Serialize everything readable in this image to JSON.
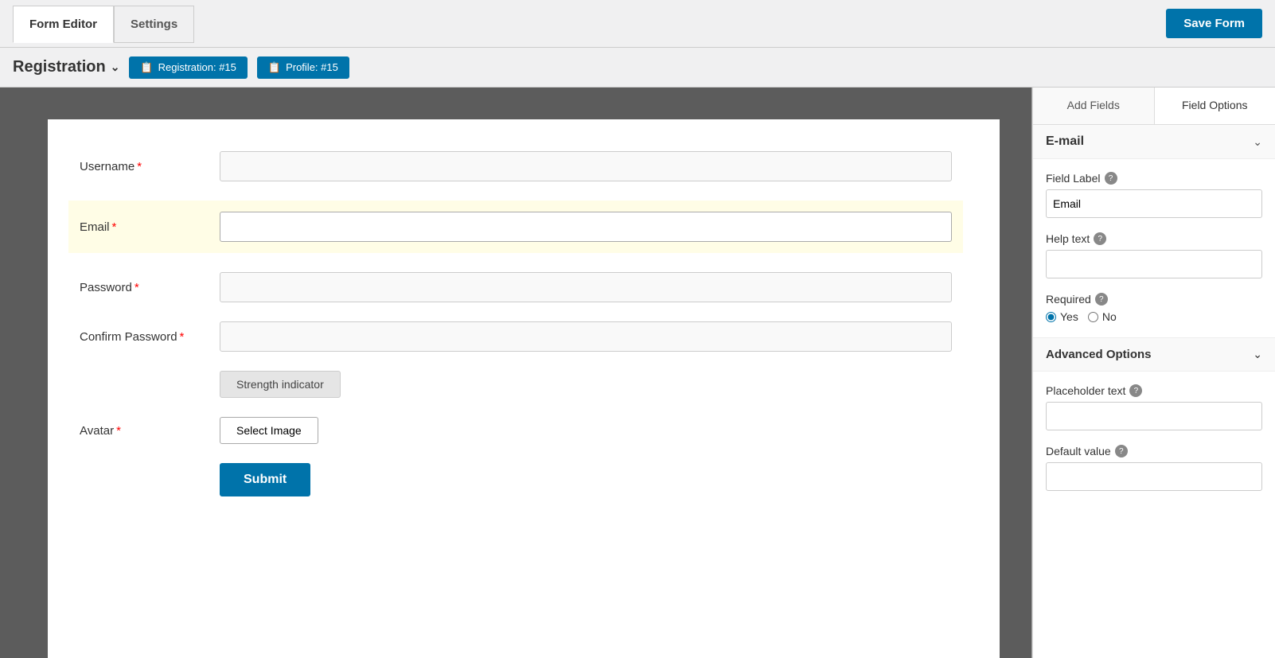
{
  "topbar": {
    "tab_form_editor": "Form Editor",
    "tab_settings": "Settings",
    "save_button": "Save Form"
  },
  "subheader": {
    "title": "Registration",
    "tag1_icon": "📋",
    "tag1_label": "Registration: #15",
    "tag2_icon": "📋",
    "tag2_label": "Profile: #15"
  },
  "form": {
    "fields": [
      {
        "label": "Username",
        "required": true,
        "id": "username",
        "highlighted": false
      },
      {
        "label": "Email",
        "required": true,
        "id": "email",
        "highlighted": true
      },
      {
        "label": "Password",
        "required": true,
        "id": "password",
        "highlighted": false
      },
      {
        "label": "Confirm Password",
        "required": true,
        "id": "confirm_password",
        "highlighted": false
      }
    ],
    "strength_indicator": "Strength indicator",
    "avatar_label": "Avatar",
    "avatar_required": true,
    "select_image_btn": "Select Image",
    "submit_btn": "Submit"
  },
  "right_panel": {
    "tab_add_fields": "Add Fields",
    "tab_field_options": "Field Options",
    "section_title": "E-mail",
    "field_label_title": "Field Label",
    "field_label_help": "?",
    "field_label_value": "Email",
    "help_text_title": "Help text",
    "help_text_help": "?",
    "help_text_value": "",
    "required_title": "Required",
    "required_help": "?",
    "required_yes": "Yes",
    "required_no": "No",
    "advanced_options_title": "Advanced Options",
    "placeholder_text_title": "Placeholder text",
    "placeholder_text_help": "?",
    "placeholder_value": "",
    "default_value_title": "Default value",
    "default_value_help": "?",
    "default_value_value": ""
  }
}
